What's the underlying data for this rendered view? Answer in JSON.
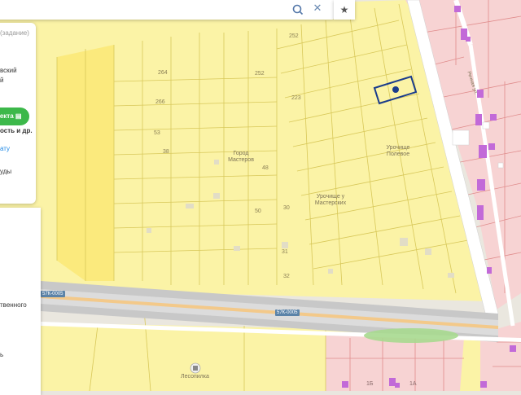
{
  "search": {
    "text": "",
    "hint": "(задание)"
  },
  "panel": {
    "line1": "вский",
    "line2": "й",
    "green_button": "ъекта",
    "line3": "ость и др.",
    "link1": "ату",
    "line4": "уды",
    "lower_text1": "твенного",
    "lower_text2": "ь"
  },
  "map": {
    "plot_numbers": {
      "p252a": "252",
      "p264": "264",
      "p252b": "252",
      "p266": "266",
      "p223": "223",
      "p53": "53",
      "p38": "38",
      "p48": "48",
      "p50": "50",
      "p30": "30",
      "p31": "31",
      "p32": "32",
      "p1b": "1Б",
      "p1a": "1А"
    },
    "places": {
      "gorod_masterov": "Город Мастеров",
      "urochishche_polevoe": "Урочище Полевое",
      "urochishche_u_masterskikh": "Урочище у Мастерских",
      "lesopilka": "Лесопилка",
      "street": "Речная ул."
    },
    "roads": {
      "r1": "57К-0005",
      "r2": "57К-0005"
    }
  }
}
